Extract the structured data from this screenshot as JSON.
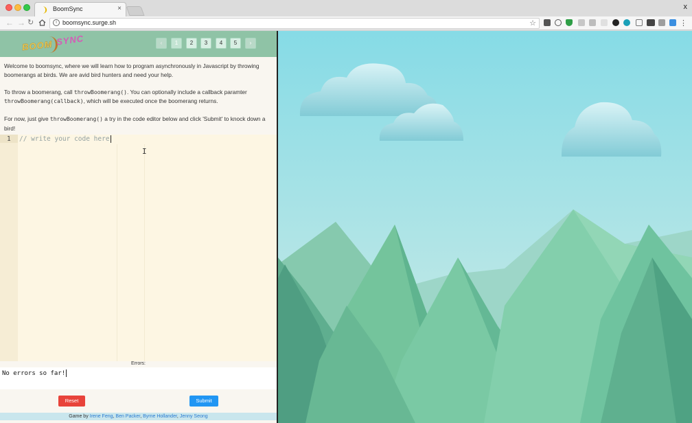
{
  "browser": {
    "tab_title": "BoomSync",
    "url": "boomsync.surge.sh",
    "close_glyph": "x"
  },
  "app": {
    "logo": {
      "left": "BOOM",
      "right": "SYNC"
    },
    "pagination": {
      "prev": "‹",
      "pages": [
        "1",
        "2",
        "3",
        "4",
        "5"
      ],
      "next": "›",
      "active_page": "1"
    },
    "intro": {
      "p1": "Welcome to boomsync, where we will learn how to program asynchronously in Javascript by throwing boomerangs at birds. We are avid bird hunters and need your help.",
      "p2_before": "To throw a boomerang, call ",
      "p2_code1": "throwBoomerang()",
      "p2_mid": ". You can optionally include a callback paramter ",
      "p2_code2": "throwBoomerang(callback)",
      "p2_after": ", which will be executed once the boomerang returns.",
      "p3_before": "For now, just give ",
      "p3_code": "throwBoomerang()",
      "p3_after": " a try in the code editor below and click 'Submit' to knock down a bird!"
    },
    "editor": {
      "line_number": "1",
      "placeholder": "// write your code here"
    },
    "errors": {
      "label": "Errors:",
      "text": "No errors so far!"
    },
    "buttons": {
      "reset": "Reset",
      "submit": "Submit"
    },
    "footer": {
      "prefix": "Game by ",
      "authors": [
        "Irene Feng",
        "Ben Packer",
        "Byrne Hollander",
        "Jenny Seong"
      ],
      "sep": ", "
    }
  },
  "colors": {
    "header": "#8fc3a6",
    "reset": "#e8433a",
    "submit": "#2196f3",
    "sky_top": "#86dbe6",
    "sky_bottom": "#d3ece6"
  }
}
